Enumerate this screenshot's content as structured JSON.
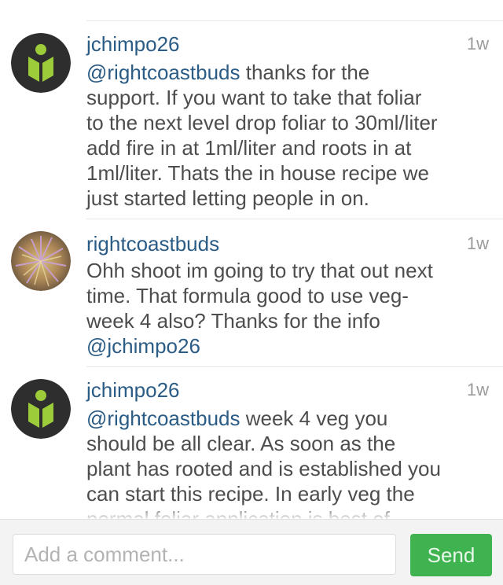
{
  "comments": [
    {
      "username": "jchimpo26",
      "time": "1w",
      "mention": "@rightcoastbuds",
      "text": " thanks for the\nsupport.  If you want to take that foliar\nto the next level drop foliar to 30ml/liter\nadd fire in at 1ml/liter and roots in at\n1ml/liter. Thats the in house recipe we\njust started letting people in on.",
      "avatar": "logo-icon"
    },
    {
      "username": "rightcoastbuds",
      "time": "1w",
      "text": "Ohh shoot im going to try that out next\ntime. That formula good to use veg-\nweek 4 also? Thanks for the info\n",
      "mention_end": "@jchimpo26",
      "avatar": "plant-photo"
    },
    {
      "username": "jchimpo26",
      "time": "1w",
      "mention": "@rightcoastbuds",
      "text": " week 4 veg you\nshould be all clear. As soon as the\nplant has rooted and is established you\ncan start this recipe.  In early veg the\nnormal foliar application is best of",
      "avatar": "logo-icon"
    }
  ],
  "composer": {
    "placeholder": "Add a comment...",
    "send_label": "Send"
  },
  "colors": {
    "username": "#2b5c85",
    "send_button": "#3fb34f",
    "logo_green": "#9ccc3a"
  }
}
